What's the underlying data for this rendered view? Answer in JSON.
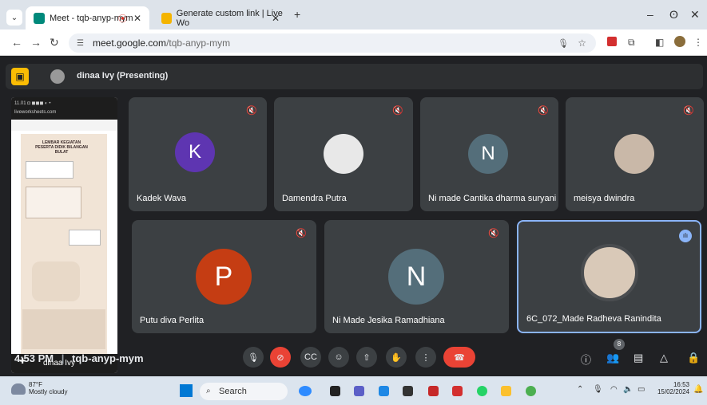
{
  "browser": {
    "tabs": [
      {
        "title": "Meet - tqb-anyp-mym",
        "icon": "meet-icon"
      },
      {
        "title": "Generate custom link | Live Wo",
        "icon": "liveworksheets-icon"
      }
    ],
    "new_tab": "+",
    "window_controls": [
      "–",
      "ʘ",
      "✕"
    ],
    "url_host": "meet.google.com",
    "url_path": "/tqb-anyp-mym"
  },
  "meet": {
    "presenting_label": "dinaa Ivy (Presenting)",
    "shared_screen": {
      "phone_status": "11.01 ◘ ◼◼◼ ◐ •",
      "phone_url": "liveworksheets.com",
      "sheet_title": "LEMBAR KEGIATAN PESERTA DIDIK BILANGAN BULAT",
      "presenter_name": "dinaa Ivy"
    },
    "participants": [
      {
        "name": "Kadek Wava",
        "initial": "K",
        "color": "#5e35b1",
        "muted": true
      },
      {
        "name": "Damendra Putra",
        "initial": "",
        "color": "#e8e8e8",
        "muted": true
      },
      {
        "name": "Ni made Cantika dharma suryani",
        "initial": "N",
        "color": "#546e7a",
        "muted": true
      },
      {
        "name": "meisya dwindra",
        "initial": "",
        "color": "#c9b8a8",
        "muted": true
      },
      {
        "name": "Putu diva Perlita",
        "initial": "P",
        "color": "#c53d13",
        "muted": true
      },
      {
        "name": "Ni Made Jesika Ramadhiana",
        "initial": "N",
        "color": "#546e7a",
        "muted": true
      },
      {
        "name": "6C_072_Made Radheva Ranindita",
        "initial": "",
        "color": "#d9c9b8",
        "muted": false
      }
    ],
    "time": "4:53 PM",
    "separator": "|",
    "meeting_code": "tqb-anyp-mym",
    "people_count": "8"
  },
  "taskbar": {
    "temp": "87°F",
    "weather": "Mostly cloudy",
    "search": "Search",
    "clock_time": "16:53",
    "clock_date": "15/02/2024"
  }
}
